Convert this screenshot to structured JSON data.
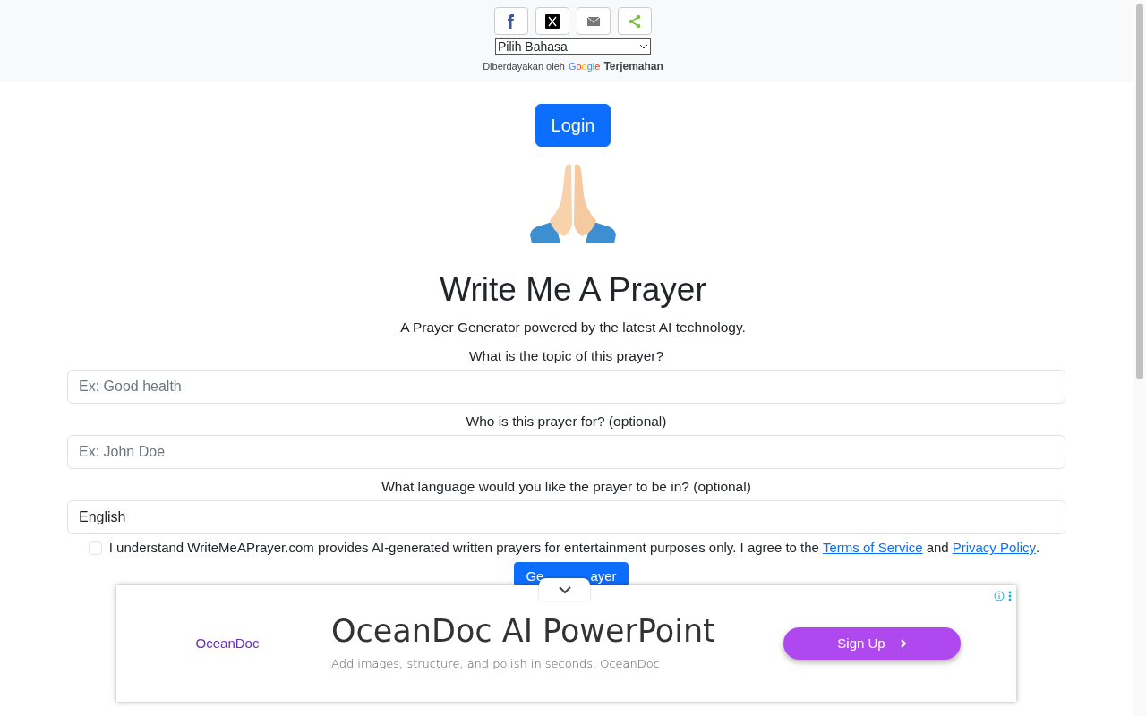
{
  "share_buttons": [
    {
      "kind": "facebook"
    },
    {
      "kind": "x"
    },
    {
      "kind": "email"
    },
    {
      "kind": "share"
    }
  ],
  "translate": {
    "select_value": "Pilih Bahasa",
    "powered_by": "Diberdayakan oleh",
    "google": "Google",
    "product": "Terjemahan"
  },
  "login_button": "Login",
  "title": "Write Me A Prayer",
  "subtitle": "A Prayer Generator powered by the latest AI technology.",
  "fields": [
    {
      "label": "What is the topic of this prayer?",
      "placeholder": "Ex: Good health"
    },
    {
      "label": "Who is this prayer for? (optional)",
      "placeholder": "Ex: John Doe"
    },
    {
      "label": "What language would you like the prayer to be in? (optional)",
      "value": "English"
    }
  ],
  "agreement": {
    "checked": false,
    "text": "I understand WriteMeAPrayer.com provides AI-generated written prayers for entertainment purposes only. I agree to the",
    "terms_link": "Terms of Service",
    "and": "and",
    "privacy_link": "Privacy Policy",
    "end": "."
  },
  "generate_button": {
    "visible_parts": [
      "Ge",
      "ayer"
    ]
  },
  "ad": {
    "logo": "OceanDoc",
    "headline": "OceanDoc AI PowerPoint",
    "description": "Add images, structure, and polish in seconds. OceanDoc",
    "cta": "Sign Up"
  }
}
